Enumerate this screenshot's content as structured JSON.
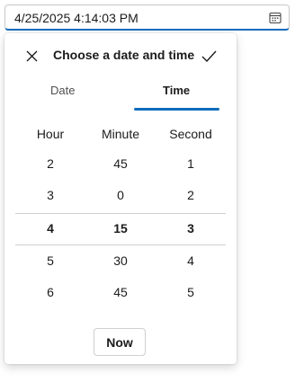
{
  "field": {
    "value": "4/25/2025 4:14:03 PM",
    "button_icon": "calendar-clock-icon"
  },
  "popup": {
    "title": "Choose a date and time",
    "close_icon": "close-icon",
    "confirm_icon": "checkmark-icon",
    "tabs": [
      {
        "label": "Date",
        "selected": false
      },
      {
        "label": "Time",
        "selected": true
      }
    ],
    "columns": [
      "Hour",
      "Minute",
      "Second"
    ],
    "rows": [
      [
        "2",
        "45",
        "1"
      ],
      [
        "3",
        "0",
        "2"
      ],
      [
        "4",
        "15",
        "3"
      ],
      [
        "5",
        "30",
        "4"
      ],
      [
        "6",
        "45",
        "5"
      ]
    ],
    "selected_row": 2,
    "now_label": "Now"
  },
  "colors": {
    "accent": "#0f6cbd",
    "divider": "#cfcfcf"
  }
}
